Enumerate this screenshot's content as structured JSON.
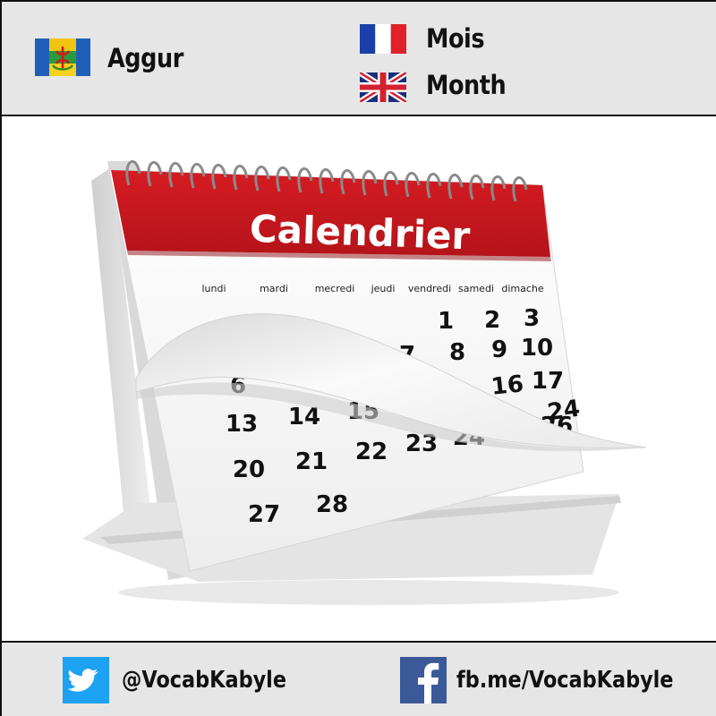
{
  "header": {
    "kabyle_word": "Aggur",
    "french_word": "Mois",
    "english_word": "Month"
  },
  "calendar": {
    "title": "Calendrier",
    "weekdays": [
      "lundi",
      "mardi",
      "mecredi",
      "jeudi",
      "vendredi",
      "samedi",
      "dimache"
    ],
    "visible_dates": [
      "1",
      "2",
      "3",
      "7",
      "8",
      "9",
      "10",
      "6",
      "16",
      "17",
      "13",
      "14",
      "15",
      "16",
      "24",
      "20",
      "21",
      "22",
      "23",
      "24",
      "25",
      "26",
      "27",
      "28"
    ],
    "accent_color": "#c8141b"
  },
  "footer": {
    "twitter_handle": "@VocabKabyle",
    "facebook_link": "fb.me/VocabKabyle"
  },
  "icons": {
    "kabyle_flag": "kabyle-flag-icon",
    "french_flag": "french-flag-icon",
    "uk_flag": "uk-flag-icon",
    "twitter": "twitter-icon",
    "facebook": "facebook-icon"
  }
}
